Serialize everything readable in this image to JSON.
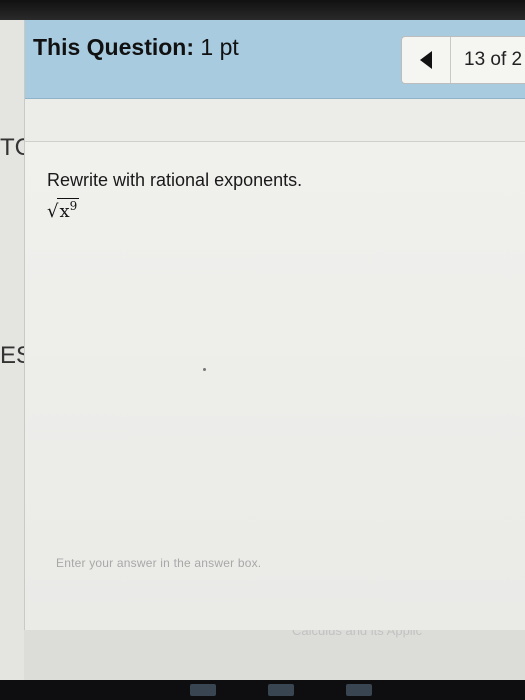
{
  "header": {
    "question_label": "This Question:",
    "points": "1 pt",
    "counter": "13 of 2"
  },
  "sidebar_fragments": [
    "TC",
    "ES"
  ],
  "question": {
    "prompt": "Rewrite with rational exponents.",
    "expression": {
      "radical_symbol": "√",
      "base": "x",
      "exponent": "9"
    }
  },
  "answer_hint": "Enter your answer in the answer box.",
  "footer": {
    "partial_text": "Calculus and its Applic"
  },
  "icons": {
    "prev": "triangle-left-icon"
  }
}
